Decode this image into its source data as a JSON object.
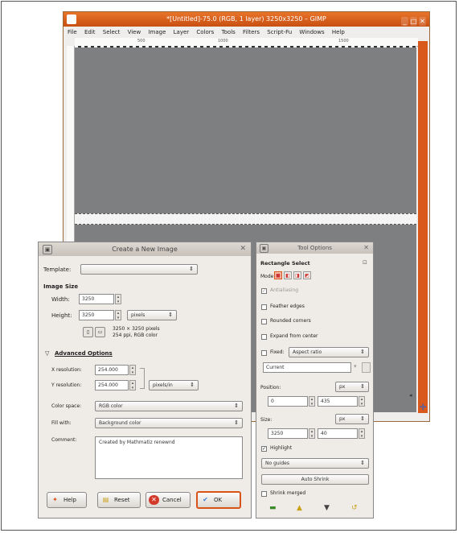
{
  "gimp": {
    "title": "*[Untitled]-75.0 (RGB, 1 layer) 3250x3250 – GIMP",
    "window_buttons": [
      "_",
      "□",
      "✕"
    ],
    "menu": [
      "File",
      "Edit",
      "Select",
      "View",
      "Image",
      "Layer",
      "Colors",
      "Tools",
      "Filters",
      "Script-Fu",
      "Windows",
      "Help"
    ],
    "ruler_ticks": [
      "500",
      "1000",
      "1500"
    ]
  },
  "dialog": {
    "title": "Create a New Image",
    "template_label": "Template:",
    "template_value": "",
    "image_size_heading": "Image Size",
    "width_label": "Width:",
    "width_value": "3250",
    "height_label": "Height:",
    "height_value": "3250",
    "unit_value": "pixels",
    "size_info_1": "3250 × 3250 pixels",
    "size_info_2": "254 ppi, RGB color",
    "advanced_label": "Advanced Options",
    "xres_label": "X resolution:",
    "xres_value": "254.000",
    "yres_label": "Y resolution:",
    "yres_value": "254.000",
    "res_unit_value": "pixels/in",
    "colorspace_label": "Color space:",
    "colorspace_value": "RGB color",
    "fillwith_label": "Fill with:",
    "fillwith_value": "Background color",
    "comment_label": "Comment:",
    "comment_value": "Created by Mathmatiz renewnd",
    "buttons": {
      "help": "Help",
      "reset": "Reset",
      "cancel": "Cancel",
      "ok": "OK"
    }
  },
  "tool_options": {
    "title": "Tool Options",
    "tool_name": "Rectangle Select",
    "mode_label": "Mode:",
    "antialiasing_label": "Antialiasing",
    "feather_label": "Feather edges",
    "rounded_label": "Rounded corners",
    "expand_label": "Expand from center",
    "fixed_label": "Fixed:",
    "fixed_value": "Aspect ratio",
    "current_value": "Current",
    "position_label": "Position:",
    "position_unit": "px",
    "position_x": "0",
    "position_y": "435",
    "size_label": "Size:",
    "size_unit": "px",
    "size_w": "3250",
    "size_h": "40",
    "highlight_label": "Highlight",
    "guides_value": "No guides",
    "autoshrink_label": "Auto Shrink",
    "shrink_merged_label": "Shrink merged"
  },
  "colors": {
    "gimp_titlebar": "#d9581b",
    "canvas_gray": "#7d7f81",
    "ok_border": "#d85418"
  }
}
